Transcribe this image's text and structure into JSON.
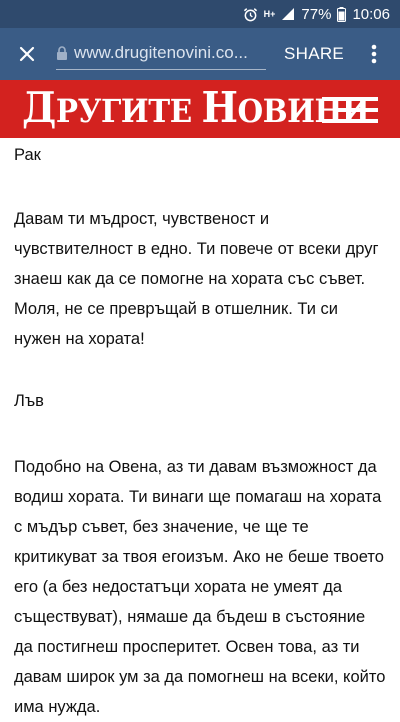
{
  "status_bar": {
    "network_type": "H+",
    "battery_percent": "77%",
    "time": "10:06",
    "icons": [
      "alarm-icon",
      "signal-icon",
      "battery-icon"
    ]
  },
  "toolbar": {
    "url": "www.drugitenovini.co...",
    "share_label": "SHARE",
    "close_icon": "close-icon",
    "menu_icon": "more-vert-icon"
  },
  "site_header": {
    "logo_first_cap": "Д",
    "logo_first_rest": "РУГИТЕ ",
    "logo_second_cap": "Н",
    "logo_second_rest": "ОВИНИ",
    "menu_icon": "hamburger-menu-icon",
    "background": "#d3221f"
  },
  "article": {
    "sign1_title": "Рак",
    "sign1_text": "Давам ти мъдрост, чувственост и чувствителност в едно. Ти повече от всеки друг знаеш как да се помогне на хората със съвет. Моля, не се превръщай в отшелник. Ти си нужен на хората!",
    "sign2_title": "Лъв",
    "sign2_text": "Подобно на Овена, аз ти давам възможност да водиш хората. Ти винаги ще помагаш на хората с мъдър съвет, без значение, че ще те критикуват за твоя егоизъм. Ако не беше твоето его (а без недостатъци хората не умеят да съществуват), нямаше да бъдеш в състояние да постигнеш просперитет. Освен това, аз ти давам широк ум за да помогнеш на всеки, който има нужда."
  }
}
